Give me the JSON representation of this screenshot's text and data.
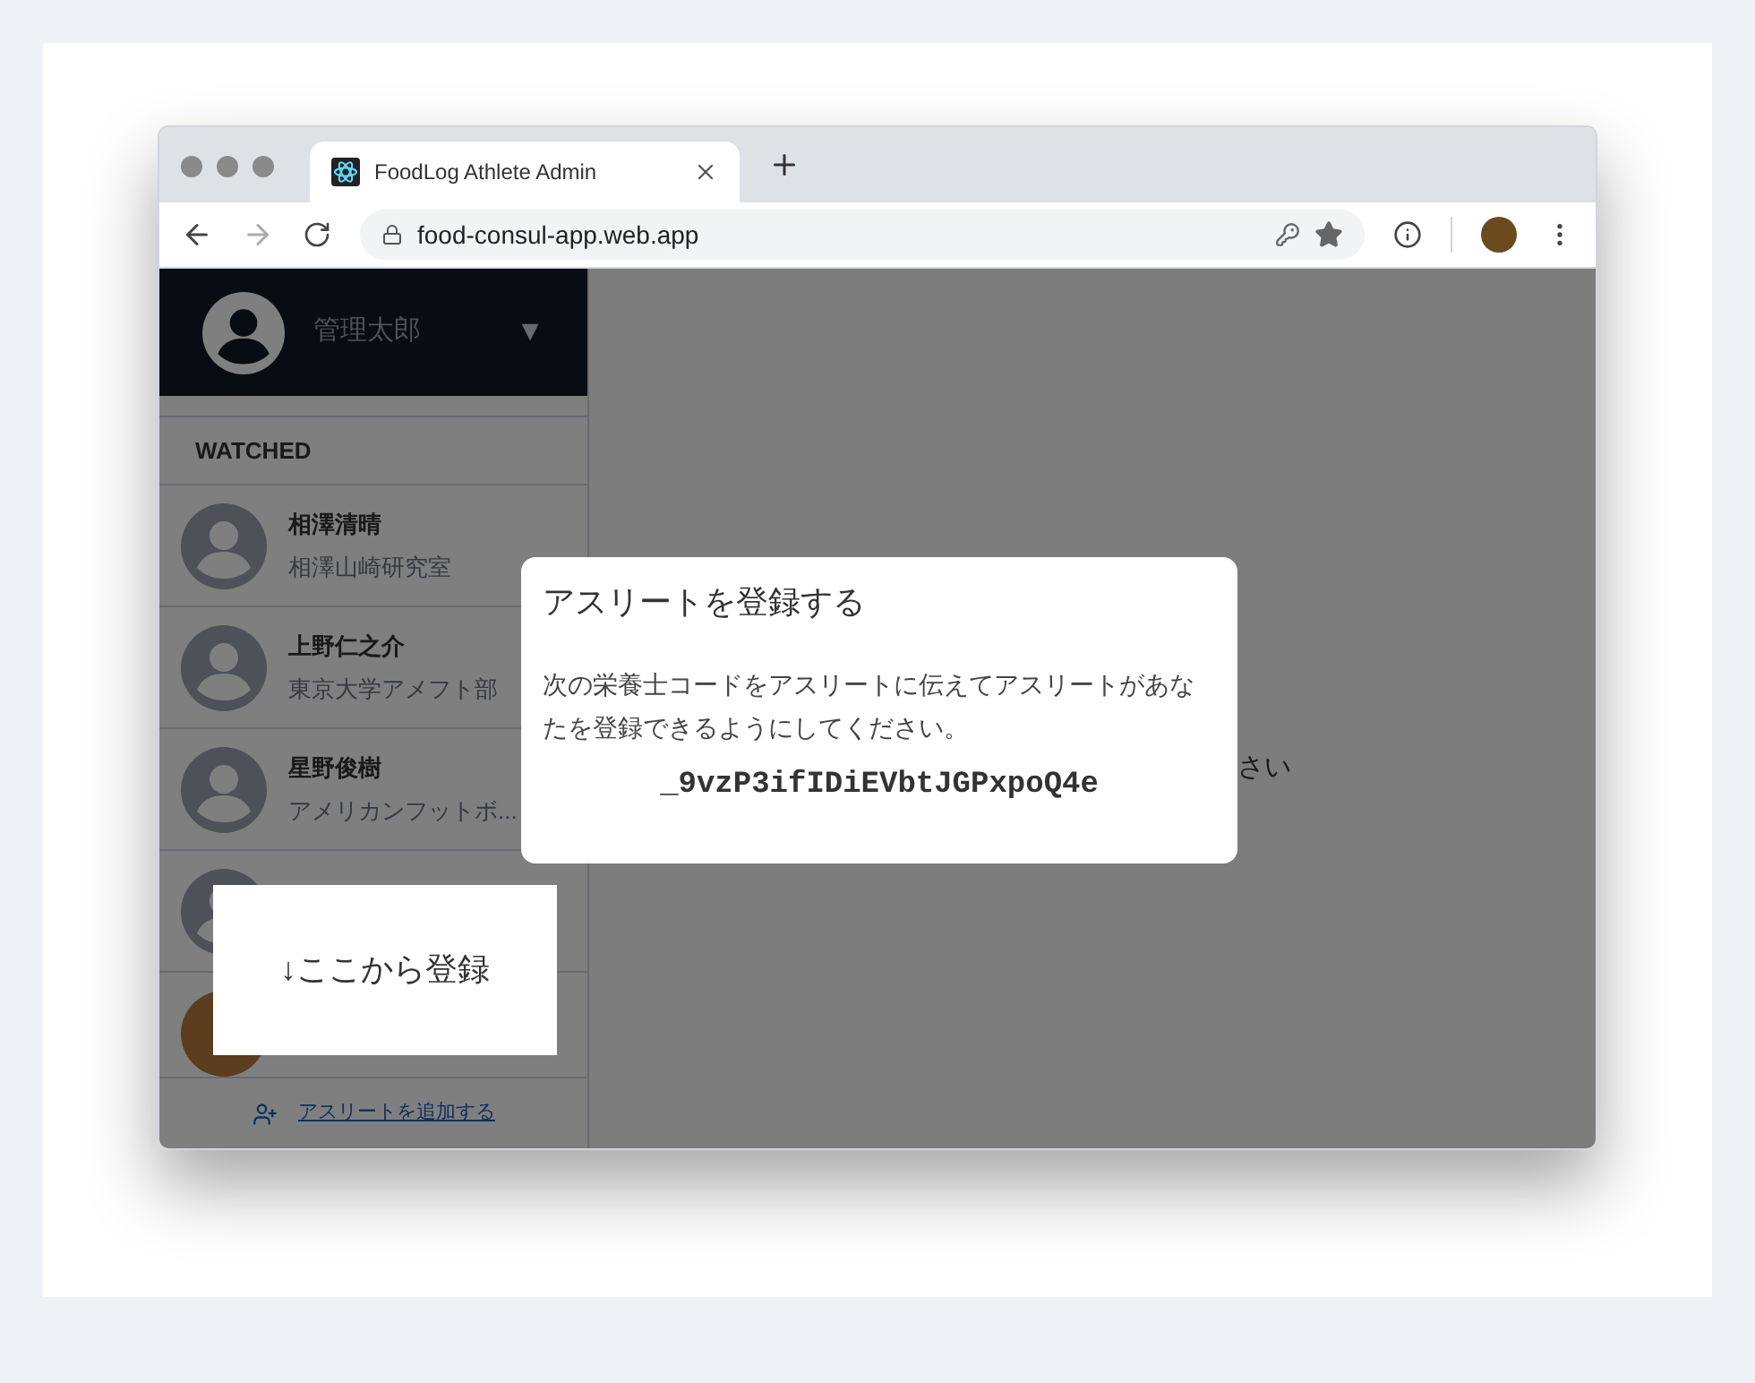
{
  "browser": {
    "tab": {
      "title": "FoodLog Athlete Admin"
    },
    "url": "food-consul-app.web.app"
  },
  "sidebar": {
    "user": {
      "name": "管理太郎",
      "caret": "▼"
    },
    "section": "WATCHED",
    "athletes": [
      {
        "kind": "default",
        "name": "相澤清晴",
        "team": "相澤山崎研究室"
      },
      {
        "kind": "default",
        "name": "上野仁之介",
        "team": "東京大学アメフト部"
      },
      {
        "kind": "default",
        "name": "星野俊樹",
        "team": "アメリカンフットボ..."
      },
      {
        "kind": "default"
      },
      {
        "kind": "photo"
      }
    ],
    "add_link": "アスリートを追加する"
  },
  "main": {
    "text": "さい"
  },
  "dialog": {
    "title": "アスリートを登録する",
    "body": "次の栄養士コードをアスリートに伝えてアスリートがあなたを登録できるようにしてください。",
    "code": "_9vzP3ifIDiEVbtJGPxpoQ4e"
  },
  "callout": {
    "text": "↓ここから登録"
  }
}
